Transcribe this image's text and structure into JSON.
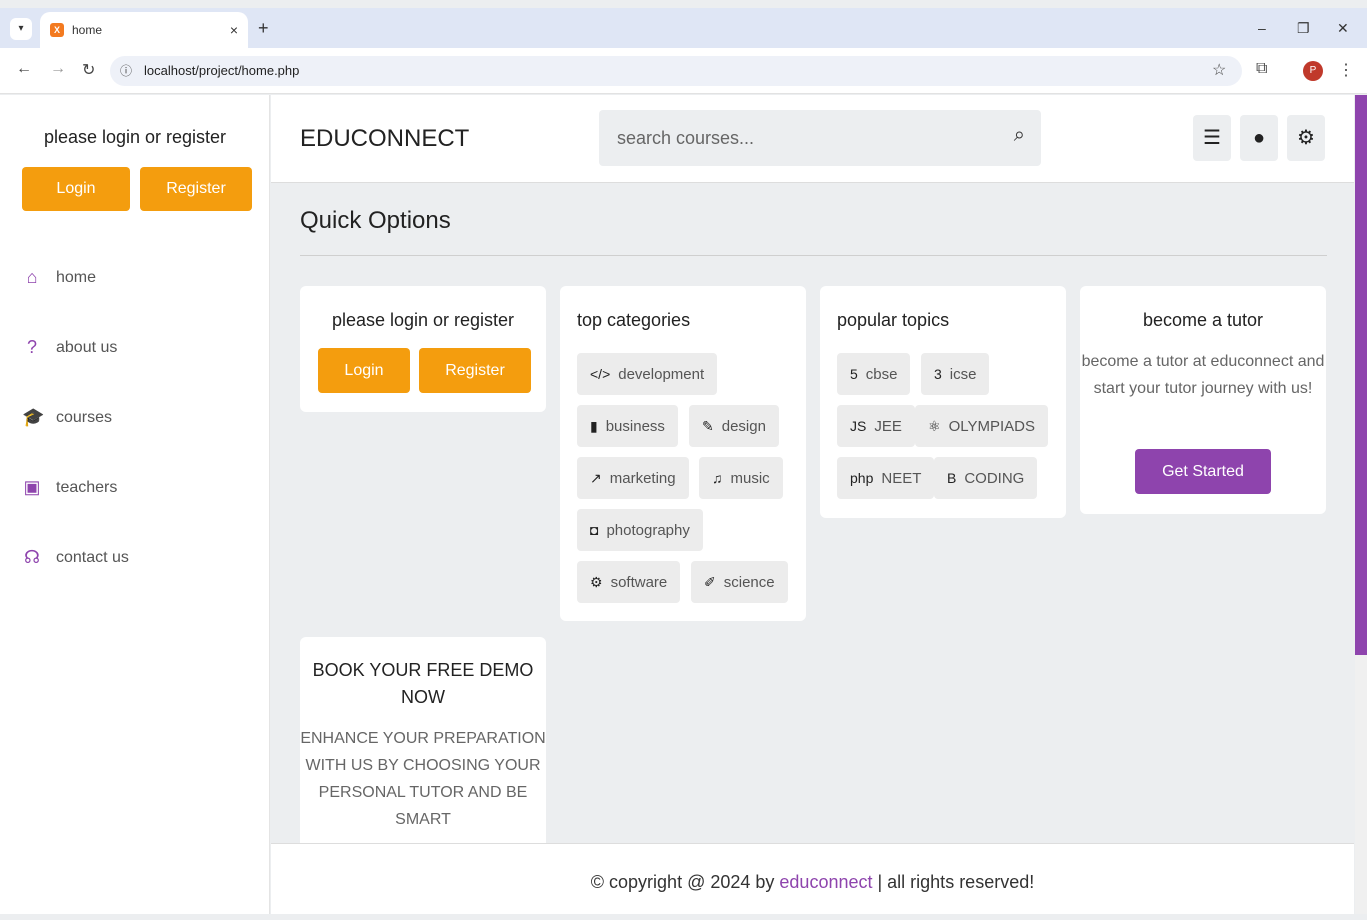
{
  "browser": {
    "tab_title": "home",
    "favicon": "X",
    "url": "localhost/project/home.php",
    "profile_initial": "P"
  },
  "sidebar": {
    "title": "please login or register",
    "login_label": "Login",
    "register_label": "Register",
    "nav": [
      {
        "label": "home",
        "icon": "home-icon"
      },
      {
        "label": "about us",
        "icon": "question-icon"
      },
      {
        "label": "courses",
        "icon": "graduation-cap-icon"
      },
      {
        "label": "teachers",
        "icon": "chalkboard-teacher-icon"
      },
      {
        "label": "contact us",
        "icon": "headset-icon"
      }
    ]
  },
  "header": {
    "logo": "EDUCONNECT",
    "search_placeholder": "search courses..."
  },
  "main": {
    "title": "Quick Options",
    "login_card": {
      "title": "please login or register",
      "login_label": "Login",
      "register_label": "Register"
    },
    "categories": {
      "title": "top categories",
      "items": [
        {
          "label": "development",
          "icon": "code-icon"
        },
        {
          "label": "business",
          "icon": "chart-bar-icon"
        },
        {
          "label": "design",
          "icon": "pen-icon"
        },
        {
          "label": "marketing",
          "icon": "chart-line-icon"
        },
        {
          "label": "music",
          "icon": "music-icon"
        },
        {
          "label": "photography",
          "icon": "camera-icon"
        },
        {
          "label": "software",
          "icon": "cog-icon"
        },
        {
          "label": "science",
          "icon": "vial-icon"
        }
      ]
    },
    "topics": {
      "title": "popular topics",
      "items": [
        {
          "label": "cbse",
          "icon": "html5-icon"
        },
        {
          "label": "icse",
          "icon": "css3-icon"
        },
        {
          "label": "JEE",
          "icon": "js-icon"
        },
        {
          "label": "OLYMPIADS",
          "icon": "react-icon"
        },
        {
          "label": "NEET",
          "icon": "php-icon"
        },
        {
          "label": "CODING",
          "icon": "bootstrap-icon"
        }
      ]
    },
    "tutor": {
      "title": "become a tutor",
      "text": "become a tutor at educonnect and start your tutor journey with us!",
      "button": "Get Started"
    },
    "demo": {
      "title": "BOOK YOUR FREE DEMO NOW",
      "text": "ENHANCE YOUR PREPARATION WITH US BY CHOOSING YOUR PERSONAL TUTOR AND BE SMART"
    }
  },
  "footer": {
    "prefix": "© copyright @ 2024 by ",
    "brand": "educonnect",
    "suffix": " | all rights reserved!"
  },
  "colors": {
    "accent": "#8e44ad",
    "orange": "#f49d0e"
  }
}
